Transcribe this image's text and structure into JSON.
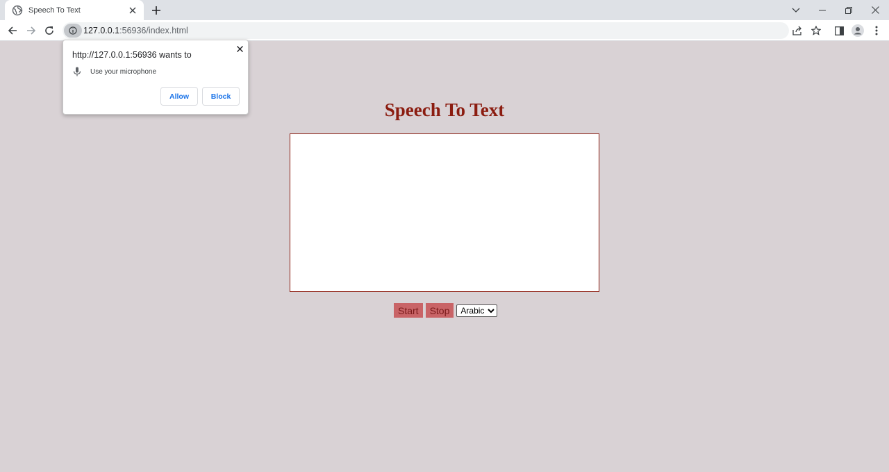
{
  "browser": {
    "tab_title": "Speech To Text",
    "url_host": "127.0.0.1",
    "url_path": ":56936/index.html"
  },
  "permission_popup": {
    "title": "http://127.0.0.1:56936 wants to",
    "permission_text": "Use your microphone",
    "allow_label": "Allow",
    "block_label": "Block"
  },
  "page": {
    "heading": "Speech To Text",
    "textarea_value": "",
    "start_label": "Start",
    "stop_label": "Stop",
    "language_selected": "Arabic",
    "colors": {
      "background": "#d9d2d5",
      "heading": "#8b1c10",
      "button_bg": "#c96467",
      "button_text": "#7a1a1a"
    }
  },
  "icons": {
    "favicon": "globe-icon",
    "mic": "microphone-icon"
  }
}
